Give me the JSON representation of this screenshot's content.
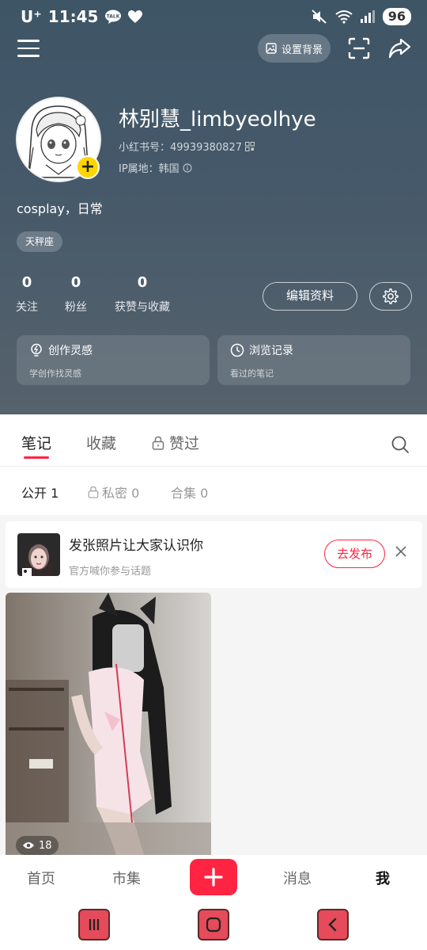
{
  "status_bar": {
    "carrier": "U⁺",
    "time": "11:45",
    "battery": "96",
    "talk_label": "TALK"
  },
  "topbar": {
    "set_background_label": "设置背景"
  },
  "profile": {
    "username": "林别慧_limbyeolhye",
    "red_id": "小红书号：49939380827",
    "ip_location": "IP属地：韩国",
    "bio": "cosplay，日常",
    "tag": "天秤座",
    "stats": [
      {
        "count": "0",
        "label": "关注"
      },
      {
        "count": "0",
        "label": "粉丝"
      },
      {
        "count": "0",
        "label": "获赞与收藏"
      }
    ],
    "edit_label": "编辑资料"
  },
  "cards": [
    {
      "title": "创作灵感",
      "sub": "学创作找灵感"
    },
    {
      "title": "浏览记录",
      "sub": "看过的笔记"
    }
  ],
  "tabs": [
    {
      "label": "笔记"
    },
    {
      "label": "收藏"
    },
    {
      "label": "赞过"
    }
  ],
  "subtabs": [
    {
      "label": "公开 1"
    },
    {
      "label": "私密 0"
    },
    {
      "label": "合集 0"
    }
  ],
  "promo": {
    "title": "发张照片让大家认识你",
    "sub": "官方喊你参与话题",
    "button": "去发布"
  },
  "note": {
    "views": "18"
  },
  "bottom_nav": [
    {
      "label": "首页"
    },
    {
      "label": "市集"
    },
    {
      "label": "消息"
    },
    {
      "label": "我"
    }
  ],
  "colors": {
    "accent": "#ff2442",
    "header_bg": "#46596a",
    "badge_yellow": "#ffd600"
  }
}
